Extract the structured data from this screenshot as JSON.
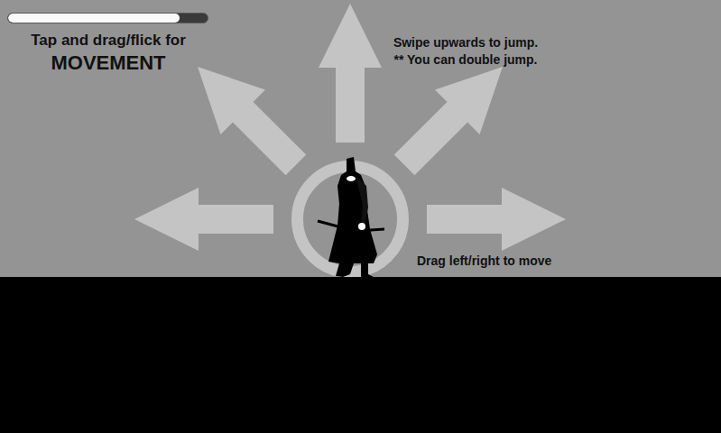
{
  "hud": {
    "health_bar": {
      "level": 0.86
    }
  },
  "instructions": {
    "title": "Tap and drag/flick for",
    "heading": "MOVEMENT",
    "jump": [
      "Swipe upwards to jump.",
      "** You can double jump."
    ],
    "move": "Drag left/right to move"
  }
}
